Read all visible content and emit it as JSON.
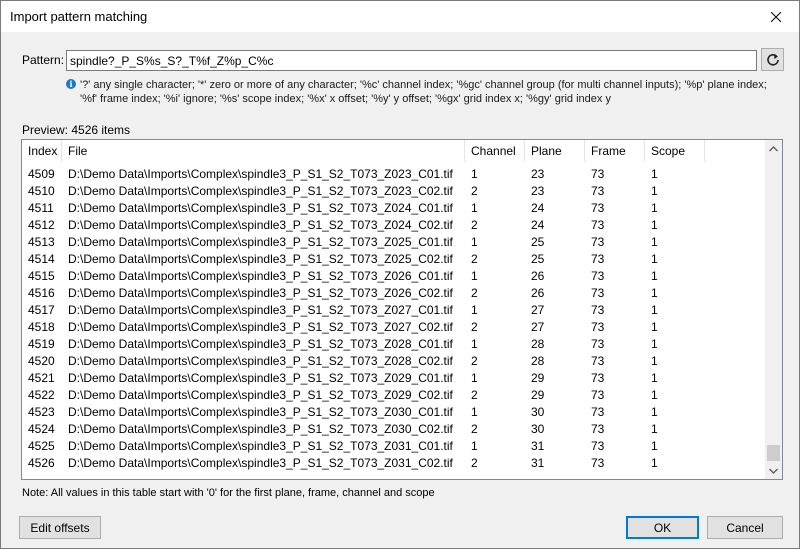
{
  "window": {
    "title": "Import pattern matching"
  },
  "pattern": {
    "label": "Pattern:",
    "value": "spindle?_P_S%s_S?_T%f_Z%p_C%c"
  },
  "help": {
    "text": "'?' any single character; '*' zero or more of any character; '%c' channel index; '%gc' channel group (for multi channel inputs); '%p' plane index; '%f' frame index; '%i' ignore; '%s' scope index; '%x' x offset; '%y' y offset; '%gx' grid index x; '%gy' grid index y"
  },
  "preview": {
    "label": "Preview: 4526 items"
  },
  "table": {
    "columns": [
      "Index",
      "File",
      "Channel",
      "Plane",
      "Frame",
      "Scope"
    ],
    "rows": [
      [
        "4509",
        "D:\\Demo Data\\Imports\\Complex\\spindle3_P_S1_S2_T073_Z023_C01.tif",
        "1",
        "23",
        "73",
        "1"
      ],
      [
        "4510",
        "D:\\Demo Data\\Imports\\Complex\\spindle3_P_S1_S2_T073_Z023_C02.tif",
        "2",
        "23",
        "73",
        "1"
      ],
      [
        "4511",
        "D:\\Demo Data\\Imports\\Complex\\spindle3_P_S1_S2_T073_Z024_C01.tif",
        "1",
        "24",
        "73",
        "1"
      ],
      [
        "4512",
        "D:\\Demo Data\\Imports\\Complex\\spindle3_P_S1_S2_T073_Z024_C02.tif",
        "2",
        "24",
        "73",
        "1"
      ],
      [
        "4513",
        "D:\\Demo Data\\Imports\\Complex\\spindle3_P_S1_S2_T073_Z025_C01.tif",
        "1",
        "25",
        "73",
        "1"
      ],
      [
        "4514",
        "D:\\Demo Data\\Imports\\Complex\\spindle3_P_S1_S2_T073_Z025_C02.tif",
        "2",
        "25",
        "73",
        "1"
      ],
      [
        "4515",
        "D:\\Demo Data\\Imports\\Complex\\spindle3_P_S1_S2_T073_Z026_C01.tif",
        "1",
        "26",
        "73",
        "1"
      ],
      [
        "4516",
        "D:\\Demo Data\\Imports\\Complex\\spindle3_P_S1_S2_T073_Z026_C02.tif",
        "2",
        "26",
        "73",
        "1"
      ],
      [
        "4517",
        "D:\\Demo Data\\Imports\\Complex\\spindle3_P_S1_S2_T073_Z027_C01.tif",
        "1",
        "27",
        "73",
        "1"
      ],
      [
        "4518",
        "D:\\Demo Data\\Imports\\Complex\\spindle3_P_S1_S2_T073_Z027_C02.tif",
        "2",
        "27",
        "73",
        "1"
      ],
      [
        "4519",
        "D:\\Demo Data\\Imports\\Complex\\spindle3_P_S1_S2_T073_Z028_C01.tif",
        "1",
        "28",
        "73",
        "1"
      ],
      [
        "4520",
        "D:\\Demo Data\\Imports\\Complex\\spindle3_P_S1_S2_T073_Z028_C02.tif",
        "2",
        "28",
        "73",
        "1"
      ],
      [
        "4521",
        "D:\\Demo Data\\Imports\\Complex\\spindle3_P_S1_S2_T073_Z029_C01.tif",
        "1",
        "29",
        "73",
        "1"
      ],
      [
        "4522",
        "D:\\Demo Data\\Imports\\Complex\\spindle3_P_S1_S2_T073_Z029_C02.tif",
        "2",
        "29",
        "73",
        "1"
      ],
      [
        "4523",
        "D:\\Demo Data\\Imports\\Complex\\spindle3_P_S1_S2_T073_Z030_C01.tif",
        "1",
        "30",
        "73",
        "1"
      ],
      [
        "4524",
        "D:\\Demo Data\\Imports\\Complex\\spindle3_P_S1_S2_T073_Z030_C02.tif",
        "2",
        "30",
        "73",
        "1"
      ],
      [
        "4525",
        "D:\\Demo Data\\Imports\\Complex\\spindle3_P_S1_S2_T073_Z031_C01.tif",
        "1",
        "31",
        "73",
        "1"
      ],
      [
        "4526",
        "D:\\Demo Data\\Imports\\Complex\\spindle3_P_S1_S2_T073_Z031_C02.tif",
        "2",
        "31",
        "73",
        "1"
      ]
    ]
  },
  "note": {
    "text": "Note: All values in this table start with '0' for the first plane, frame, channel and scope"
  },
  "buttons": {
    "edit_offsets": "Edit offsets",
    "ok": "OK",
    "cancel": "Cancel"
  },
  "icons": {
    "close": "close-icon",
    "reset": "refresh-icon",
    "info": "info-icon",
    "scroll_up": "chevron-up-icon",
    "scroll_down": "chevron-down-icon"
  },
  "colors": {
    "info": "#1979ca",
    "ok_border": "#0078d7"
  }
}
